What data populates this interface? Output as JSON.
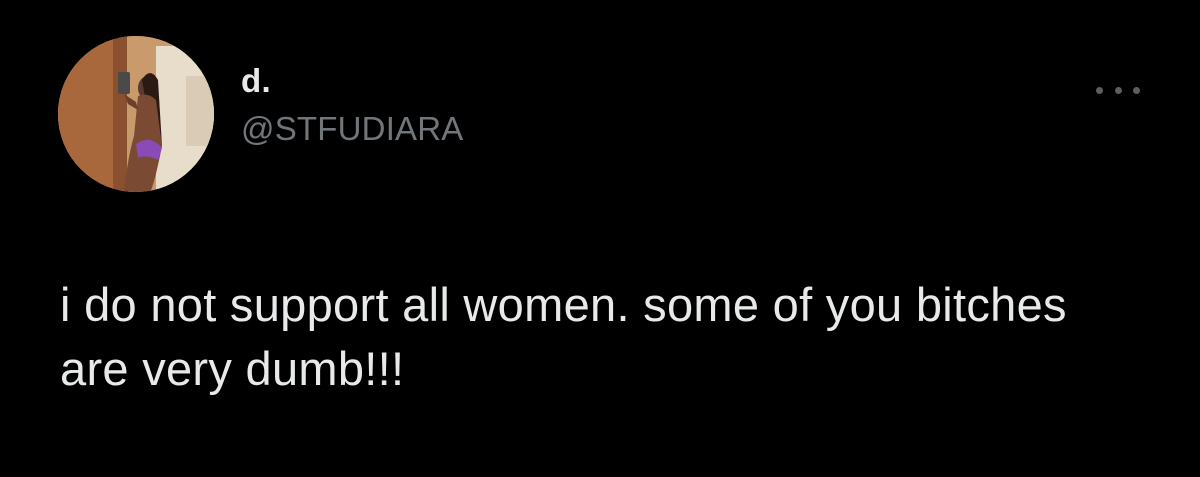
{
  "tweet": {
    "author": {
      "display_name": "d.",
      "handle": "@STFUDIARA",
      "avatar_icon": "profile-photo"
    },
    "more_icon": "more-options-icon",
    "text": "i do not support all women. some of you bitches are very dumb!!!"
  },
  "colors": {
    "background": "#000000",
    "primary_text": "#e7e9ea",
    "secondary_text": "#71767b"
  }
}
